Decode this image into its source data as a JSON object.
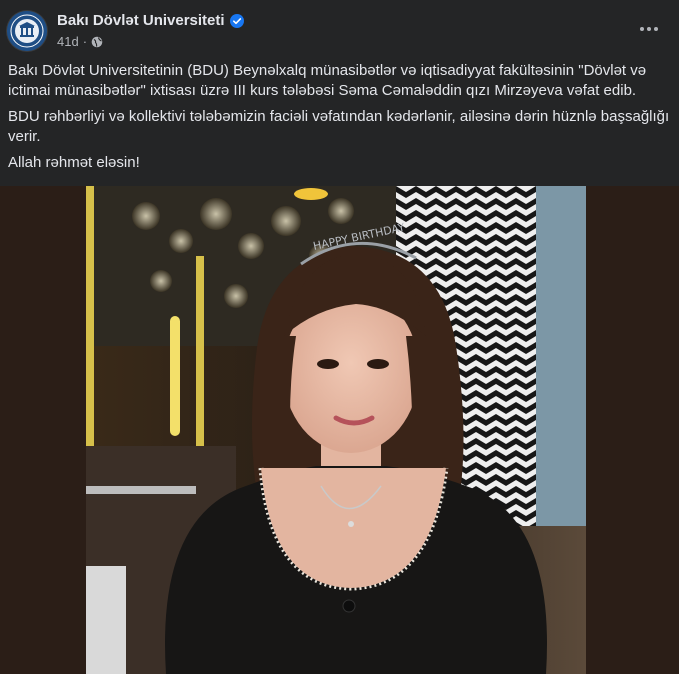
{
  "post": {
    "author": "Bakı Dövlət Universiteti",
    "time": "41d",
    "visibility_icon": "globe-icon",
    "verified_icon": "verified-badge-icon",
    "more_icon": "more-options-icon",
    "paragraphs": [
      "Bakı Dövlət Universitetinin (BDU) Beynəlxalq münasibətlər və iqtisadiyyat fakültəsinin \"Dövlət və ictimai münasibətlər\" ixtisası üzrə III kurs tələbəsi Səma Cəmaləddin qızı Mirzəyeva  vəfat edib.",
      "BDU rəhbərliyi və kollektivi tələbəmizin faciəli vəfatından kədərlənir, ailəsinə dərin hüznlə başsağlığı verir.",
      "Allah rəhmət eləsin!"
    ],
    "photo_caption": "HAPPY BIRTHDAY"
  },
  "colors": {
    "background": "#242526",
    "text": "#e4e6eb",
    "secondary_text": "#b0b3b8",
    "verified_blue": "#1877f2"
  }
}
